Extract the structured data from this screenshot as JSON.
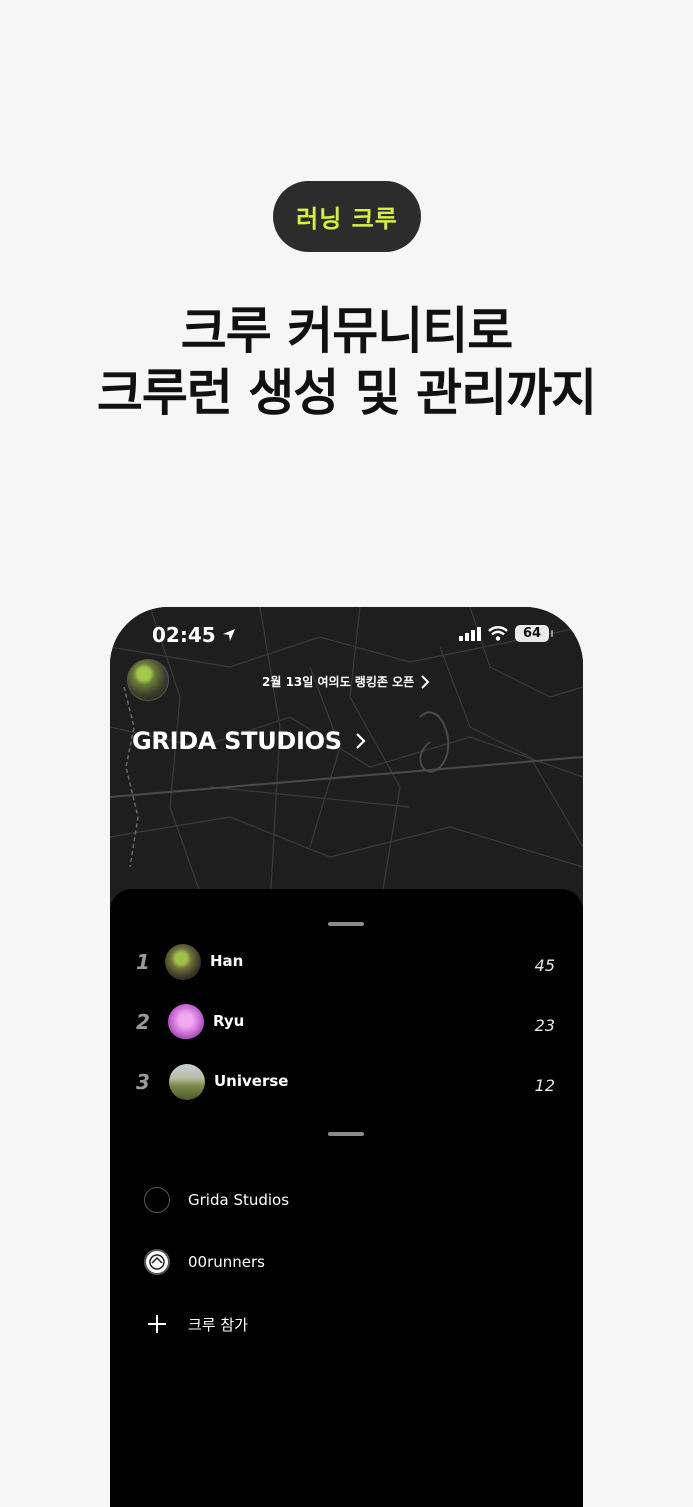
{
  "banner": {
    "badge": "러닝 크루",
    "headline_line1": "크루 커뮤니티로",
    "headline_line2": "크루런 생성 및 관리까지"
  },
  "status_bar": {
    "time": "02:45",
    "battery": "64"
  },
  "header": {
    "notice": "2월 13일 여의도 랭킹존 오픈",
    "crew_name": "GRIDA STUDIOS"
  },
  "ranking": [
    {
      "rank": "1",
      "name": "Han",
      "score": "45"
    },
    {
      "rank": "2",
      "name": "Ryu",
      "score": "23"
    },
    {
      "rank": "3",
      "name": "Universe",
      "score": "12"
    }
  ],
  "crews": [
    {
      "name": "Grida Studios"
    },
    {
      "name": "00runners"
    }
  ],
  "join_label": "크루 참가",
  "colors": {
    "accent": "#d6f03c",
    "sheet": "#000000",
    "map": "#1e1e1e"
  }
}
